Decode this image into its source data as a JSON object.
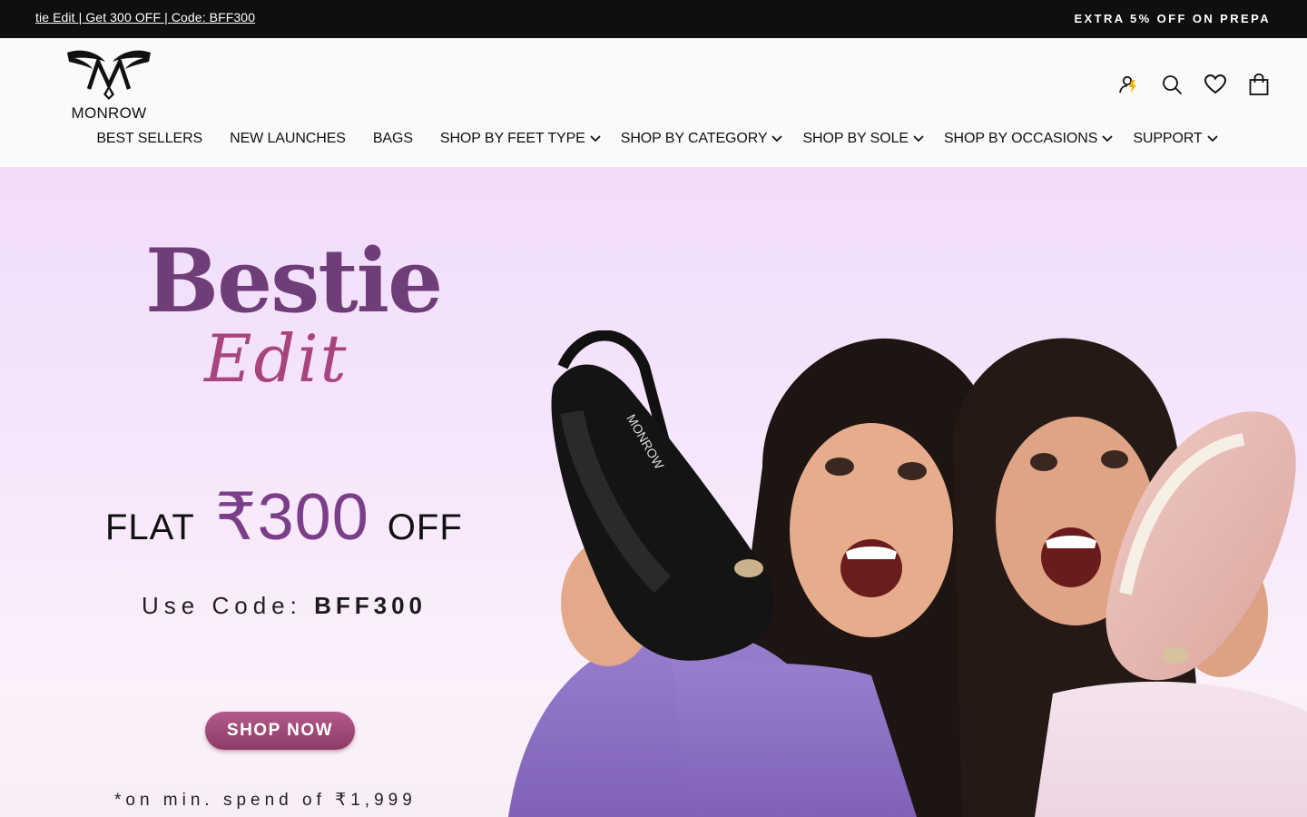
{
  "announcement": {
    "left_text": "tie Edit | Get 300 OFF | Code: BFF300",
    "right_text": "EXTRA 5% OFF ON PREPA"
  },
  "brand": {
    "name": "MONROW"
  },
  "header_icons": [
    "account-icon",
    "search-icon",
    "wishlist-heart-icon",
    "cart-bag-icon"
  ],
  "nav": {
    "items": [
      {
        "label": "BEST SELLERS",
        "has_dropdown": false
      },
      {
        "label": "NEW LAUNCHES",
        "has_dropdown": false
      },
      {
        "label": "BAGS",
        "has_dropdown": false
      },
      {
        "label": "SHOP BY FEET TYPE",
        "has_dropdown": true
      },
      {
        "label": "SHOP BY CATEGORY",
        "has_dropdown": true
      },
      {
        "label": "SHOP BY SOLE",
        "has_dropdown": true
      },
      {
        "label": "SHOP BY OCCASIONS",
        "has_dropdown": true
      },
      {
        "label": "SUPPORT",
        "has_dropdown": true
      }
    ]
  },
  "hero": {
    "title": "Bestie",
    "script": "Edit",
    "offer_prefix": "FLAT",
    "offer_amount": "₹300",
    "offer_suffix": "OFF",
    "code_label": "Use Code: ",
    "code_value": "BFF300",
    "button_label": "SHOP NOW",
    "footnote": "*on min. spend of ₹1,999",
    "sandal_brand": "MONROW"
  },
  "colors": {
    "announce_bg": "#0f0f0f",
    "hero_bg": "#f1dcfa",
    "title_purple": "#6f3d78",
    "script_pink": "#a8457e",
    "button": "#9c4572"
  }
}
